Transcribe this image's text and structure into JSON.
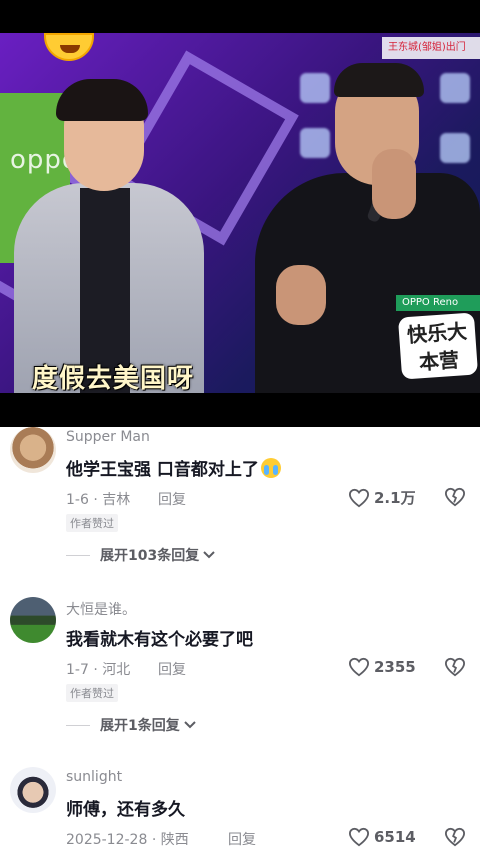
{
  "video": {
    "subtitle": "度假去美国呀",
    "brand_left": "oppo",
    "top_banner": "王东城(邹姐)出门",
    "oppo_tag": "OPPO  Reno",
    "show_logo": "快乐大本营"
  },
  "comments": [
    {
      "username": "Supper Man",
      "text": "他学王宝强 口音都对上了",
      "has_emoji": true,
      "date": "1-6",
      "location": "吉林",
      "reply_label": "回复",
      "author_liked": "作者赞过",
      "likes": "2.1万",
      "expand_label": "展开103条回复"
    },
    {
      "username": "大恒是谁。",
      "text": "我看就木有这个必要了吧",
      "has_emoji": false,
      "date": "1-7",
      "location": "河北",
      "reply_label": "回复",
      "author_liked": "作者赞过",
      "likes": "2355",
      "expand_label": "展开1条回复"
    },
    {
      "username": "sunlight",
      "text": "师傅，还有多久",
      "has_emoji": false,
      "date": "2025-12-28",
      "location": "陕西",
      "reply_label": "回复",
      "likes": "6514"
    }
  ],
  "icons": {
    "like": "heart-outline-icon",
    "dislike": "broken-heart-icon",
    "expand": "chevron-down-icon"
  }
}
